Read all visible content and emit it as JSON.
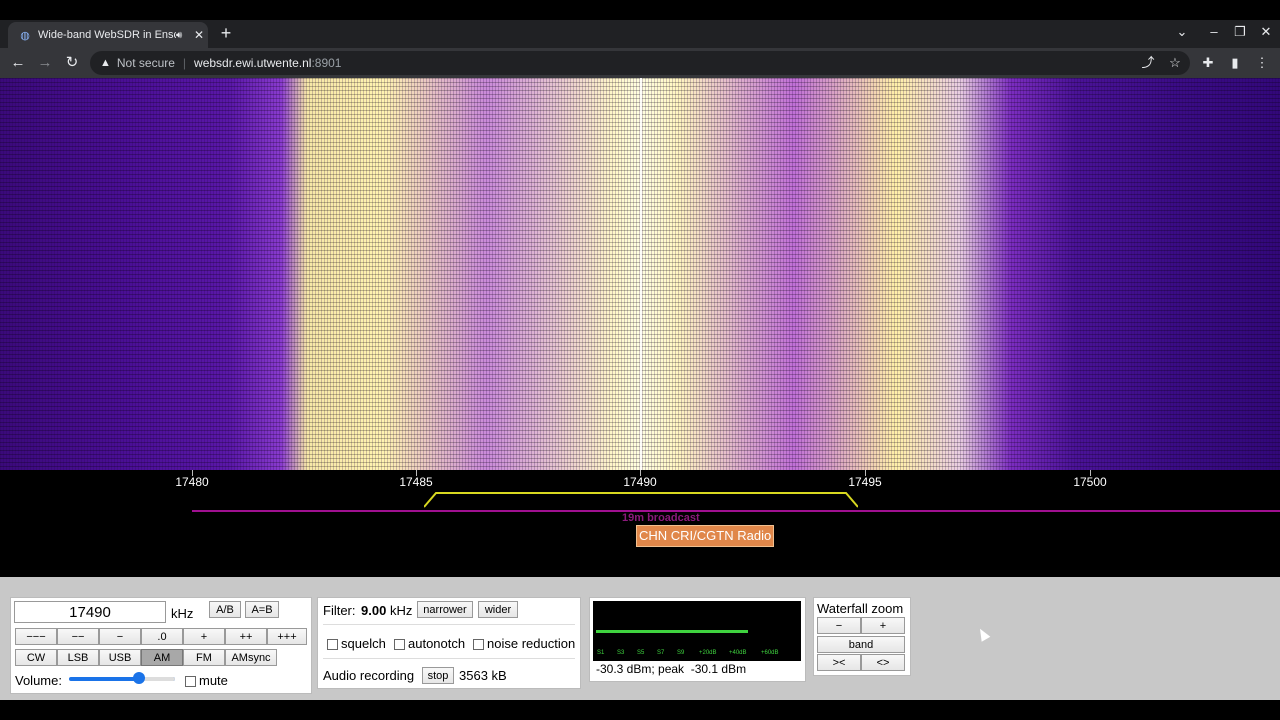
{
  "browser": {
    "tab_title": "Wide-band WebSDR in Enschede",
    "security_label": "Not secure",
    "url_host": "websdr.ewi.utwente.nl",
    "url_port": ":8901"
  },
  "scale": {
    "tick_labels": [
      "17480",
      "17485",
      "17490",
      "17495",
      "17500"
    ],
    "band_label": "19m broadcast",
    "station_label": "CHN CRI/CGTN Radio"
  },
  "frequency": {
    "value": "17490",
    "unit": "kHz",
    "ab_label": "A/B",
    "aeqb_label": "A=B",
    "step_buttons": [
      "−−−",
      "−−",
      "−",
      ".0",
      "+",
      "++",
      "+++"
    ],
    "modes": [
      "CW",
      "LSB",
      "USB",
      "AM",
      "FM",
      "AMsync"
    ],
    "active_mode": "AM",
    "volume_label": "Volume:",
    "volume_level": 0.65,
    "mute_label": "mute"
  },
  "filter": {
    "label": "Filter:",
    "value": "9.00",
    "unit": "kHz",
    "narrower_label": "narrower",
    "wider_label": "wider",
    "squelch_label": "squelch",
    "autonotch_label": "autonotch",
    "noise_reduction_label": "noise reduction",
    "recording_label": "Audio recording",
    "stop_label": "stop",
    "recording_size": "3563 kB"
  },
  "smeter": {
    "scale_labels": [
      "S1",
      "S3",
      "S5",
      "S7",
      "S9",
      "+20dB",
      "+40dB",
      "+60dB"
    ],
    "readout": "-30.3 dBm; peak  -30.1 dBm",
    "bar_color": "#3fd33f"
  },
  "zoom": {
    "title": "Waterfall zoom",
    "minus_label": "−",
    "plus_label": "+",
    "band_label": "band",
    "narrow_label": "><",
    "widen_label": "<>"
  },
  "colors": {
    "station_bg": "#e0874a",
    "passband": "#d8d820",
    "band_line": "#a01090"
  }
}
